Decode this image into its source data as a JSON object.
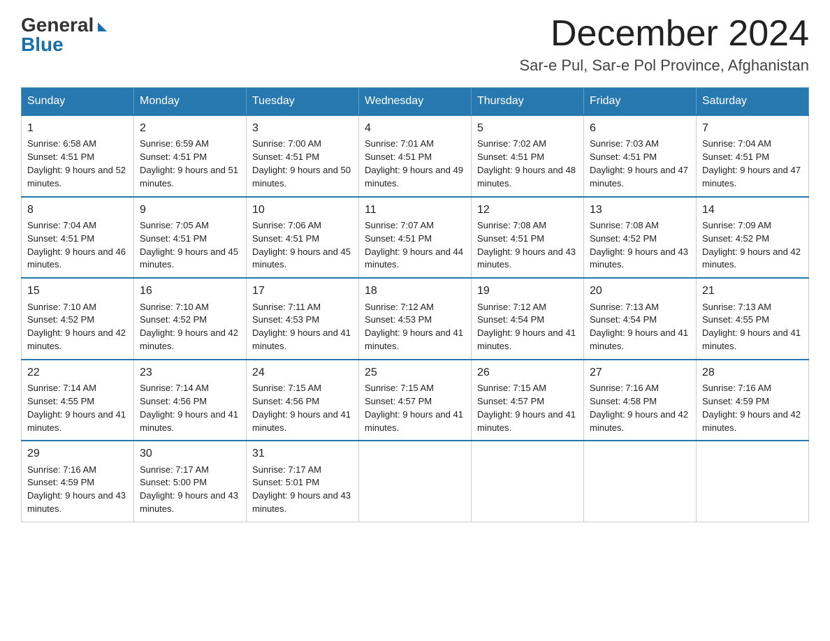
{
  "logo": {
    "general": "General",
    "blue": "Blue"
  },
  "header": {
    "month_year": "December 2024",
    "location": "Sar-e Pul, Sar-e Pol Province, Afghanistan"
  },
  "days_of_week": [
    "Sunday",
    "Monday",
    "Tuesday",
    "Wednesday",
    "Thursday",
    "Friday",
    "Saturday"
  ],
  "weeks": [
    [
      {
        "day": "1",
        "sunrise": "Sunrise: 6:58 AM",
        "sunset": "Sunset: 4:51 PM",
        "daylight": "Daylight: 9 hours and 52 minutes."
      },
      {
        "day": "2",
        "sunrise": "Sunrise: 6:59 AM",
        "sunset": "Sunset: 4:51 PM",
        "daylight": "Daylight: 9 hours and 51 minutes."
      },
      {
        "day": "3",
        "sunrise": "Sunrise: 7:00 AM",
        "sunset": "Sunset: 4:51 PM",
        "daylight": "Daylight: 9 hours and 50 minutes."
      },
      {
        "day": "4",
        "sunrise": "Sunrise: 7:01 AM",
        "sunset": "Sunset: 4:51 PM",
        "daylight": "Daylight: 9 hours and 49 minutes."
      },
      {
        "day": "5",
        "sunrise": "Sunrise: 7:02 AM",
        "sunset": "Sunset: 4:51 PM",
        "daylight": "Daylight: 9 hours and 48 minutes."
      },
      {
        "day": "6",
        "sunrise": "Sunrise: 7:03 AM",
        "sunset": "Sunset: 4:51 PM",
        "daylight": "Daylight: 9 hours and 47 minutes."
      },
      {
        "day": "7",
        "sunrise": "Sunrise: 7:04 AM",
        "sunset": "Sunset: 4:51 PM",
        "daylight": "Daylight: 9 hours and 47 minutes."
      }
    ],
    [
      {
        "day": "8",
        "sunrise": "Sunrise: 7:04 AM",
        "sunset": "Sunset: 4:51 PM",
        "daylight": "Daylight: 9 hours and 46 minutes."
      },
      {
        "day": "9",
        "sunrise": "Sunrise: 7:05 AM",
        "sunset": "Sunset: 4:51 PM",
        "daylight": "Daylight: 9 hours and 45 minutes."
      },
      {
        "day": "10",
        "sunrise": "Sunrise: 7:06 AM",
        "sunset": "Sunset: 4:51 PM",
        "daylight": "Daylight: 9 hours and 45 minutes."
      },
      {
        "day": "11",
        "sunrise": "Sunrise: 7:07 AM",
        "sunset": "Sunset: 4:51 PM",
        "daylight": "Daylight: 9 hours and 44 minutes."
      },
      {
        "day": "12",
        "sunrise": "Sunrise: 7:08 AM",
        "sunset": "Sunset: 4:51 PM",
        "daylight": "Daylight: 9 hours and 43 minutes."
      },
      {
        "day": "13",
        "sunrise": "Sunrise: 7:08 AM",
        "sunset": "Sunset: 4:52 PM",
        "daylight": "Daylight: 9 hours and 43 minutes."
      },
      {
        "day": "14",
        "sunrise": "Sunrise: 7:09 AM",
        "sunset": "Sunset: 4:52 PM",
        "daylight": "Daylight: 9 hours and 42 minutes."
      }
    ],
    [
      {
        "day": "15",
        "sunrise": "Sunrise: 7:10 AM",
        "sunset": "Sunset: 4:52 PM",
        "daylight": "Daylight: 9 hours and 42 minutes."
      },
      {
        "day": "16",
        "sunrise": "Sunrise: 7:10 AM",
        "sunset": "Sunset: 4:52 PM",
        "daylight": "Daylight: 9 hours and 42 minutes."
      },
      {
        "day": "17",
        "sunrise": "Sunrise: 7:11 AM",
        "sunset": "Sunset: 4:53 PM",
        "daylight": "Daylight: 9 hours and 41 minutes."
      },
      {
        "day": "18",
        "sunrise": "Sunrise: 7:12 AM",
        "sunset": "Sunset: 4:53 PM",
        "daylight": "Daylight: 9 hours and 41 minutes."
      },
      {
        "day": "19",
        "sunrise": "Sunrise: 7:12 AM",
        "sunset": "Sunset: 4:54 PM",
        "daylight": "Daylight: 9 hours and 41 minutes."
      },
      {
        "day": "20",
        "sunrise": "Sunrise: 7:13 AM",
        "sunset": "Sunset: 4:54 PM",
        "daylight": "Daylight: 9 hours and 41 minutes."
      },
      {
        "day": "21",
        "sunrise": "Sunrise: 7:13 AM",
        "sunset": "Sunset: 4:55 PM",
        "daylight": "Daylight: 9 hours and 41 minutes."
      }
    ],
    [
      {
        "day": "22",
        "sunrise": "Sunrise: 7:14 AM",
        "sunset": "Sunset: 4:55 PM",
        "daylight": "Daylight: 9 hours and 41 minutes."
      },
      {
        "day": "23",
        "sunrise": "Sunrise: 7:14 AM",
        "sunset": "Sunset: 4:56 PM",
        "daylight": "Daylight: 9 hours and 41 minutes."
      },
      {
        "day": "24",
        "sunrise": "Sunrise: 7:15 AM",
        "sunset": "Sunset: 4:56 PM",
        "daylight": "Daylight: 9 hours and 41 minutes."
      },
      {
        "day": "25",
        "sunrise": "Sunrise: 7:15 AM",
        "sunset": "Sunset: 4:57 PM",
        "daylight": "Daylight: 9 hours and 41 minutes."
      },
      {
        "day": "26",
        "sunrise": "Sunrise: 7:15 AM",
        "sunset": "Sunset: 4:57 PM",
        "daylight": "Daylight: 9 hours and 41 minutes."
      },
      {
        "day": "27",
        "sunrise": "Sunrise: 7:16 AM",
        "sunset": "Sunset: 4:58 PM",
        "daylight": "Daylight: 9 hours and 42 minutes."
      },
      {
        "day": "28",
        "sunrise": "Sunrise: 7:16 AM",
        "sunset": "Sunset: 4:59 PM",
        "daylight": "Daylight: 9 hours and 42 minutes."
      }
    ],
    [
      {
        "day": "29",
        "sunrise": "Sunrise: 7:16 AM",
        "sunset": "Sunset: 4:59 PM",
        "daylight": "Daylight: 9 hours and 43 minutes."
      },
      {
        "day": "30",
        "sunrise": "Sunrise: 7:17 AM",
        "sunset": "Sunset: 5:00 PM",
        "daylight": "Daylight: 9 hours and 43 minutes."
      },
      {
        "day": "31",
        "sunrise": "Sunrise: 7:17 AM",
        "sunset": "Sunset: 5:01 PM",
        "daylight": "Daylight: 9 hours and 43 minutes."
      },
      null,
      null,
      null,
      null
    ]
  ]
}
